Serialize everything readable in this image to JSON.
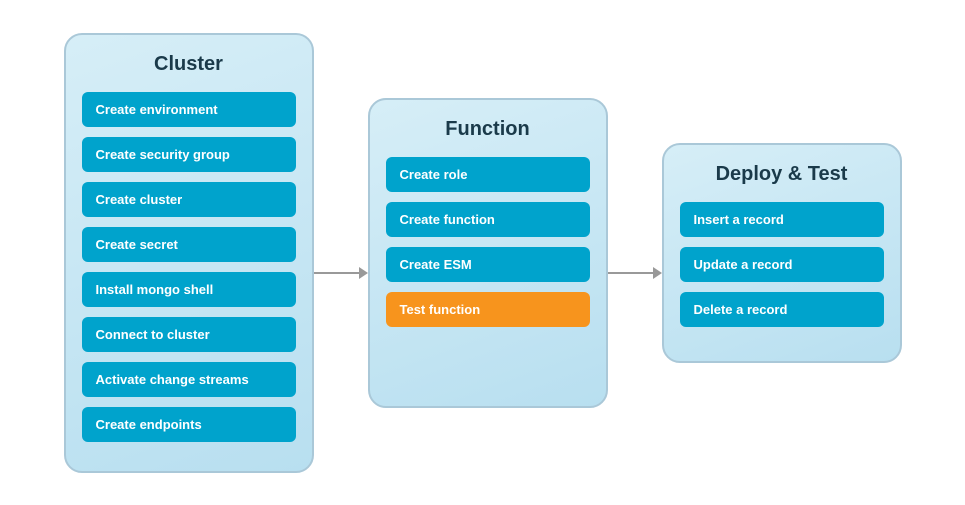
{
  "cluster": {
    "title": "Cluster",
    "buttons": [
      {
        "label": "Create environment",
        "style": "teal"
      },
      {
        "label": "Create security group",
        "style": "teal"
      },
      {
        "label": "Create cluster",
        "style": "teal"
      },
      {
        "label": "Create secret",
        "style": "teal"
      },
      {
        "label": "Install mongo shell",
        "style": "teal"
      },
      {
        "label": "Connect to cluster",
        "style": "teal"
      },
      {
        "label": "Activate change streams",
        "style": "teal"
      },
      {
        "label": "Create endpoints",
        "style": "teal"
      }
    ]
  },
  "function": {
    "title": "Function",
    "buttons": [
      {
        "label": "Create role",
        "style": "teal"
      },
      {
        "label": "Create function",
        "style": "teal"
      },
      {
        "label": "Create ESM",
        "style": "teal"
      },
      {
        "label": "Test function",
        "style": "orange"
      }
    ]
  },
  "deploy": {
    "title": "Deploy & Test",
    "buttons": [
      {
        "label": "Insert a record",
        "style": "teal"
      },
      {
        "label": "Update a record",
        "style": "teal"
      },
      {
        "label": "Delete a record",
        "style": "teal"
      }
    ]
  }
}
